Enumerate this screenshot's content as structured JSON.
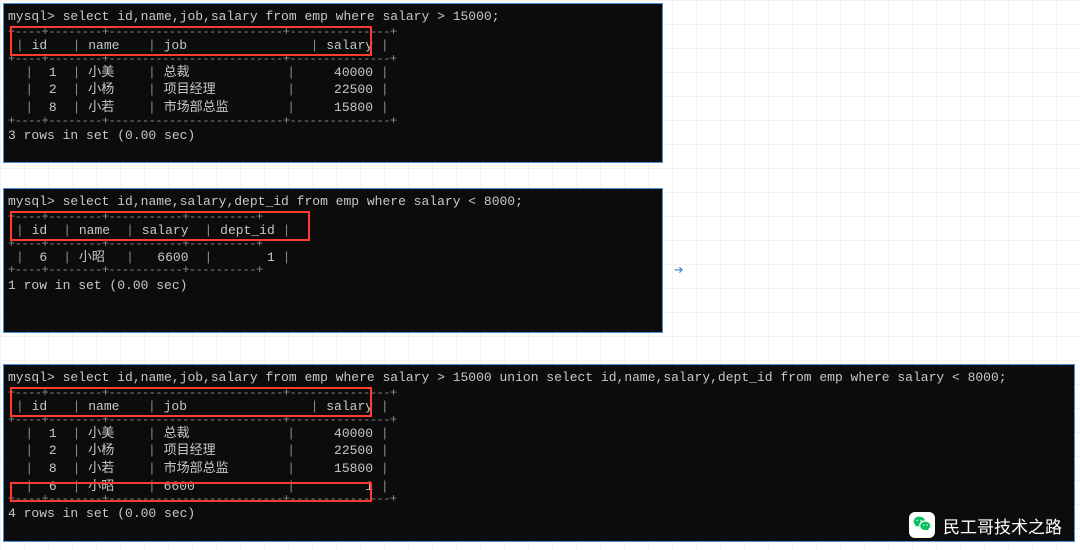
{
  "terminals": [
    {
      "prompt": "mysql>",
      "sql": "select id,name,job,salary from emp where salary > 15000;",
      "headers": [
        "id",
        "name",
        "job",
        "salary"
      ],
      "rows": [
        {
          "id": "1",
          "name": "小美",
          "job": "总裁",
          "salary": "40000"
        },
        {
          "id": "2",
          "name": "小杨",
          "job": "项目经理",
          "salary": "22500"
        },
        {
          "id": "8",
          "name": "小若",
          "job": "市场部总监",
          "salary": "15800"
        }
      ],
      "status": "3 rows in set (0.00 sec)"
    },
    {
      "prompt": "mysql>",
      "sql": "select id,name,salary,dept_id from emp where salary < 8000;",
      "headers": [
        "id",
        "name",
        "salary",
        "dept_id"
      ],
      "rows": [
        {
          "id": "6",
          "name": "小昭",
          "salary": "6600",
          "dept_id": "1"
        }
      ],
      "status": "1 row in set (0.00 sec)"
    },
    {
      "prompt": "mysql>",
      "sql": "select id,name,job,salary from emp where salary > 15000 union select id,name,salary,dept_id from emp where salary < 8000;",
      "headers": [
        "id",
        "name",
        "job",
        "salary"
      ],
      "rows": [
        {
          "id": "1",
          "name": "小美",
          "job": "总裁",
          "salary": "40000"
        },
        {
          "id": "2",
          "name": "小杨",
          "job": "项目经理",
          "salary": "22500"
        },
        {
          "id": "8",
          "name": "小若",
          "job": "市场部总监",
          "salary": "15800"
        },
        {
          "id": "6",
          "name": "小昭",
          "job": "6600",
          "salary": "1"
        }
      ],
      "status": "4 rows in set (0.00 sec)"
    }
  ],
  "watermark_text": "民工哥技术之路"
}
